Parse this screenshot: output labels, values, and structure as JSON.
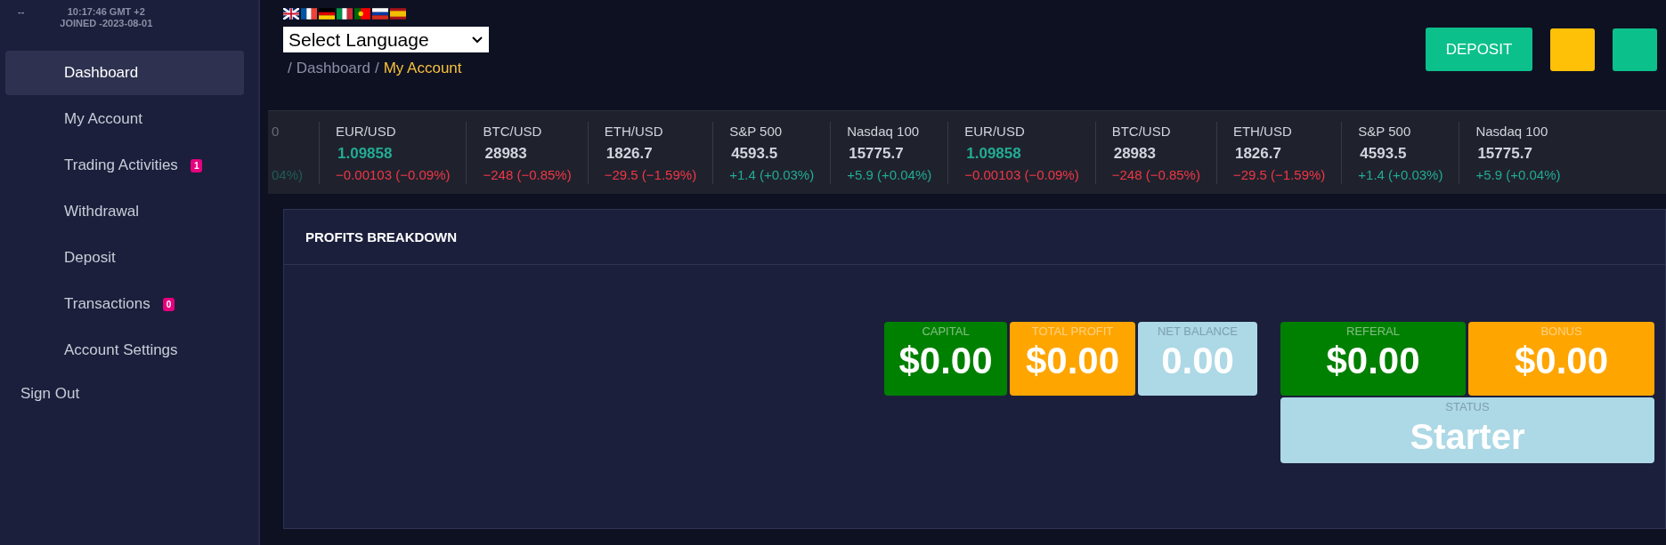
{
  "sidebar": {
    "user_name": "--",
    "time": "10:17:46 GMT +2",
    "joined": "JOINED -2023-08-01",
    "items": [
      {
        "label": "Dashboard",
        "selected": true
      },
      {
        "label": "My Account",
        "selected": false
      },
      {
        "label": "Trading Activities",
        "selected": false,
        "badge": "1"
      },
      {
        "label": "Withdrawal",
        "selected": false
      },
      {
        "label": "Deposit",
        "selected": false
      },
      {
        "label": "Transactions",
        "selected": false,
        "badge": "0"
      },
      {
        "label": "Account Settings",
        "selected": false
      }
    ],
    "sign_out": "Sign Out"
  },
  "header": {
    "flags": [
      {
        "kind": "gb"
      },
      {
        "kind": "fr"
      },
      {
        "kind": "de"
      },
      {
        "kind": "it"
      },
      {
        "kind": "pt"
      },
      {
        "kind": "ru"
      },
      {
        "kind": "es"
      }
    ],
    "language_select": "Select Language",
    "breadcrumb": [
      {
        "separator": "/",
        "label": "Dashboard",
        "current": false
      },
      {
        "separator": "/",
        "label": "My Account",
        "current": true
      }
    ],
    "deposit_button": "DEPOSIT"
  },
  "ticker": [
    {
      "kind": "partial",
      "symbol": "0",
      "change": "04%)",
      "change_up": true
    },
    {
      "kind": "full",
      "symbol": "EUR/USD",
      "price": "1.09858",
      "price_up": true,
      "change": "−0.00103 (−0.09%)",
      "change_up": false
    },
    {
      "kind": "full",
      "symbol": "BTC/USD",
      "price": "28983",
      "price_up": false,
      "change": "−248 (−0.85%)",
      "change_up": false
    },
    {
      "kind": "full",
      "symbol": "ETH/USD",
      "price": "1826.7",
      "price_up": false,
      "change": "−29.5 (−1.59%)",
      "change_up": false
    },
    {
      "kind": "full",
      "symbol": "S&P 500",
      "price": "4593.5",
      "price_up": false,
      "change": "+1.4 (+0.03%)",
      "change_up": true
    },
    {
      "kind": "full",
      "symbol": "Nasdaq 100",
      "price": "15775.7",
      "price_up": false,
      "change": "+5.9 (+0.04%)",
      "change_up": true
    },
    {
      "kind": "full",
      "symbol": "EUR/USD",
      "price": "1.09858",
      "price_up": true,
      "change": "−0.00103 (−0.09%)",
      "change_up": false
    },
    {
      "kind": "full",
      "symbol": "BTC/USD",
      "price": "28983",
      "price_up": false,
      "change": "−248 (−0.85%)",
      "change_up": false
    },
    {
      "kind": "full",
      "symbol": "ETH/USD",
      "price": "1826.7",
      "price_up": false,
      "change": "−29.5 (−1.59%)",
      "change_up": false
    },
    {
      "kind": "full",
      "symbol": "S&P 500",
      "price": "4593.5",
      "price_up": false,
      "change": "+1.4 (+0.03%)",
      "change_up": true
    },
    {
      "kind": "full",
      "symbol": "Nasdaq 100",
      "price": "15775.7",
      "price_up": false,
      "change": "+5.9 (+0.04%)",
      "change_up": true
    }
  ],
  "panel": {
    "title": "PROFITS BREAKDOWN",
    "left_cards": [
      {
        "label": "CAPITAL",
        "value": "$0.00",
        "color": "#008000"
      },
      {
        "label": "TOTAL PROFIT",
        "value": "$0.00",
        "color": "#ffa500"
      },
      {
        "label": "NET BALANCE",
        "value": "0.00",
        "color": "#add8e6"
      }
    ],
    "right_cards": [
      {
        "label": "REFERAL",
        "value": "$0.00",
        "color": "#008000"
      },
      {
        "label": "BONUS",
        "value": "$0.00",
        "color": "#ffa500"
      }
    ],
    "status": {
      "label": "STATUS",
      "value": "Starter",
      "color": "#add8e6"
    }
  }
}
